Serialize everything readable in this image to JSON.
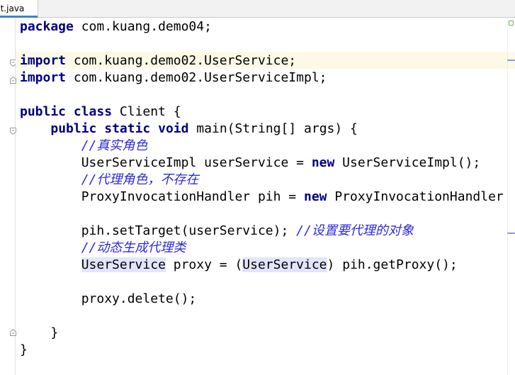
{
  "tab": {
    "file_label": "nt.java"
  },
  "code": {
    "l1": {
      "kw": "package",
      "rest": " com.kuang.demo04;"
    },
    "l3": {
      "kw": "import",
      "rest": " com.kuang.demo02.UserService;"
    },
    "l4": {
      "kw": "import",
      "rest": " com.kuang.demo02.UserServiceImpl;"
    },
    "l6": {
      "kw1": "public",
      "sp": " ",
      "kw2": "class",
      "rest": " Client {"
    },
    "l7": {
      "indent": "    ",
      "kw1": "public",
      "kw2": "static",
      "kw3": "void",
      "rest": " main(String[] args) {"
    },
    "l8": {
      "indent": "        ",
      "comment": "//真实角色"
    },
    "l9": {
      "indent": "        ",
      "pre": "UserServiceImpl userService = ",
      "kw": "new",
      "rest": " UserServiceImpl();"
    },
    "l10": {
      "indent": "        ",
      "comment": "//代理角色，不存在"
    },
    "l11": {
      "indent": "        ",
      "pre": "ProxyInvocationHandler pih = ",
      "kw": "new",
      "rest": " ProxyInvocationHandler"
    },
    "l13": {
      "indent": "        ",
      "pre": "pih.setTarget(userService); ",
      "comment": "//设置要代理的对象"
    },
    "l14": {
      "indent": "        ",
      "comment": "//动态生成代理类"
    },
    "l15": {
      "indent": "        ",
      "usage1": "UserService",
      "mid": " proxy = (",
      "usage2": "UserService",
      "rest": ") pih.getProxy();"
    },
    "l17": {
      "indent": "        ",
      "text": "proxy.delete();"
    },
    "l19": {
      "indent": "    ",
      "text": "}"
    },
    "l20": {
      "text": "}"
    }
  },
  "colors": {
    "keyword": "#000080",
    "comment": "#2d2bd8",
    "current_line": "#fcfae6",
    "usage_highlight": "#e4e4ff",
    "tab_underline": "#4083c9"
  }
}
